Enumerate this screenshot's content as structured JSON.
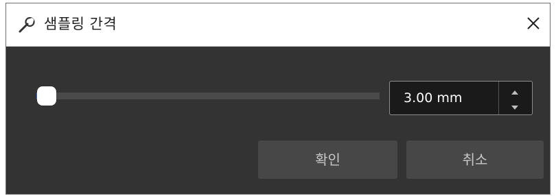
{
  "dialog": {
    "title": "샘플링 간격",
    "title_icon": "wrench-icon",
    "close_icon": "close-icon"
  },
  "slider": {
    "level_fraction": 0.03,
    "fill_color": "#2a7ad6",
    "thumb_color": "#ffffff"
  },
  "spinbox": {
    "value": "3.00 mm",
    "up_icon": "caret-up-icon",
    "down_icon": "caret-down-icon"
  },
  "buttons": {
    "ok_label": "확인",
    "cancel_label": "취소"
  },
  "colors": {
    "background": "#333333",
    "accent": "#2a7ad6",
    "button": "#474747"
  }
}
